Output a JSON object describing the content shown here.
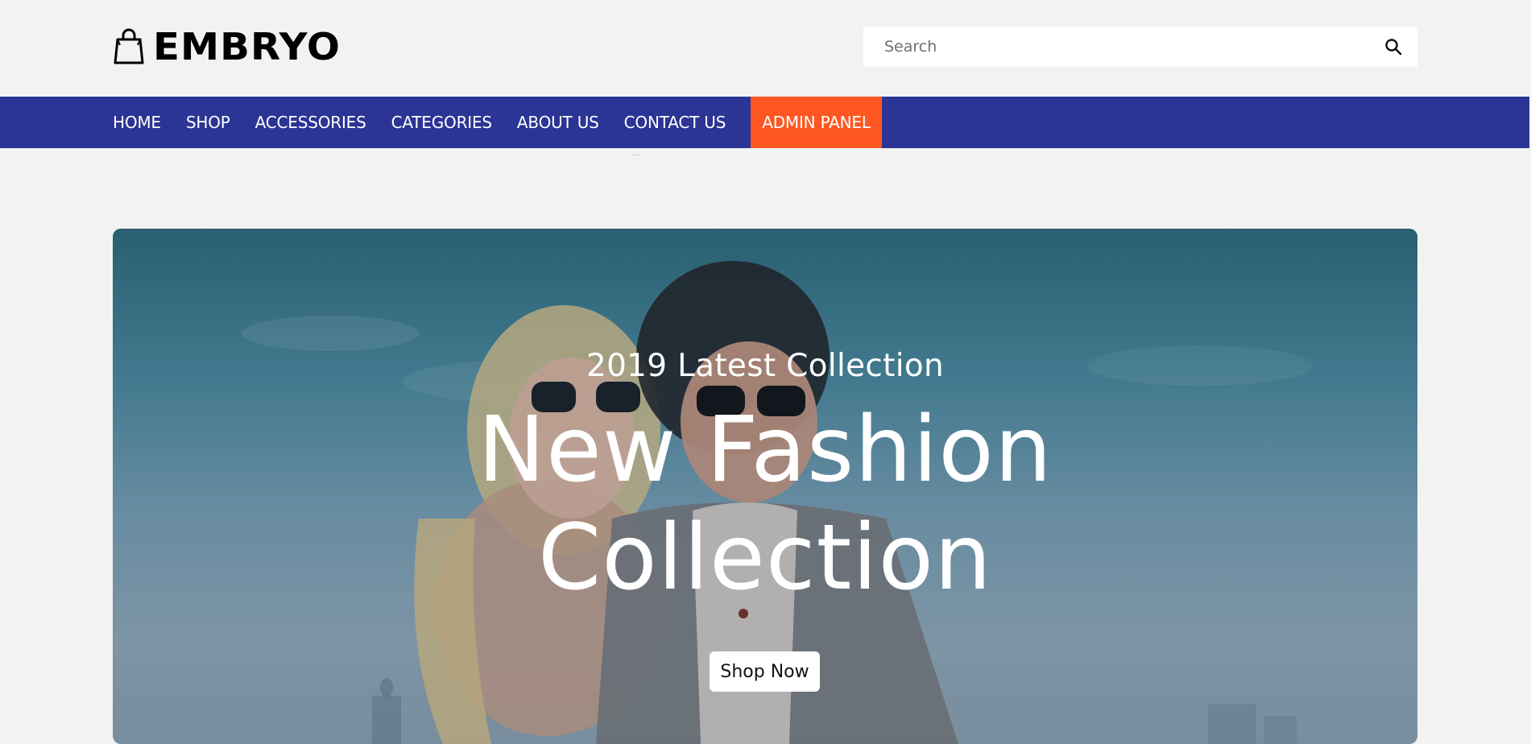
{
  "brand": {
    "name": "EMBRYO",
    "icon": "shopping-bag-icon"
  },
  "search": {
    "placeholder": "Search",
    "icon": "search-icon"
  },
  "nav": {
    "items": [
      {
        "label": "HOME"
      },
      {
        "label": "SHOP"
      },
      {
        "label": "ACCESSORIES"
      },
      {
        "label": "CATEGORIES"
      },
      {
        "label": "ABOUT US"
      },
      {
        "label": "CONTACT US"
      }
    ],
    "admin": {
      "label": "ADMIN PANEL"
    },
    "colors": {
      "bar": "#2b3595",
      "admin": "#ff5722"
    }
  },
  "hero": {
    "subtitle": "2019 Latest Collection",
    "title_line1": "New Fashion",
    "title_line2": "Collection",
    "cta": "Shop Now"
  }
}
